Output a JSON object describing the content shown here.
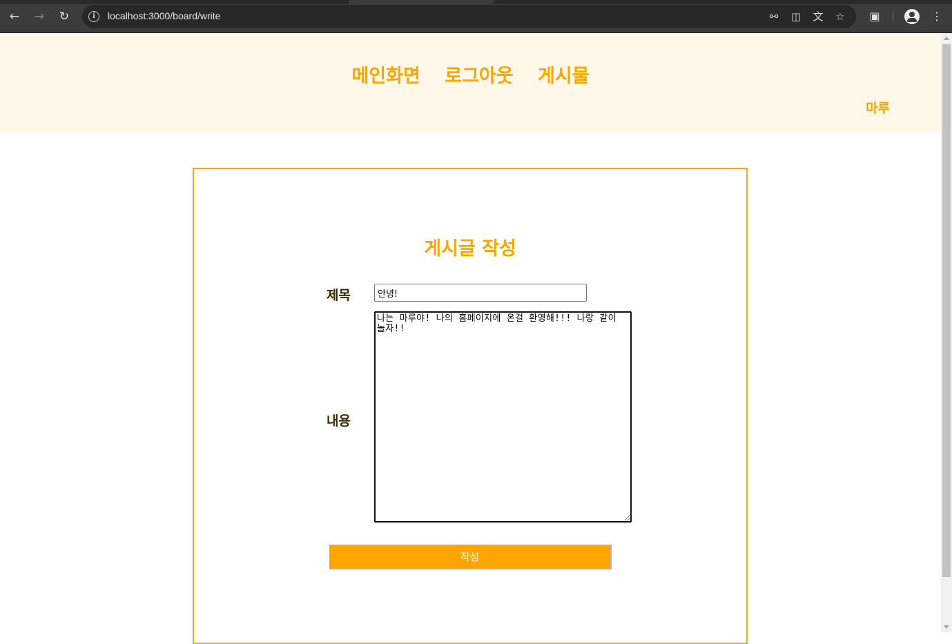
{
  "browser": {
    "url": "localhost:3000/board/write"
  },
  "header": {
    "nav": [
      "메인화면",
      "로그아웃",
      "게시물"
    ],
    "username": "마루"
  },
  "form": {
    "heading": "게시글 작성",
    "title_label": "제목",
    "title_value": "안녕!",
    "content_label": "내용",
    "content_value": "나는 마루야! 나의 홈페이지에 온걸 환영해!!! 나랑 같이 놀자!!",
    "submit_label": "작성"
  },
  "colors": {
    "accent": "#ffa500",
    "header_bg": "#fff8e9"
  }
}
